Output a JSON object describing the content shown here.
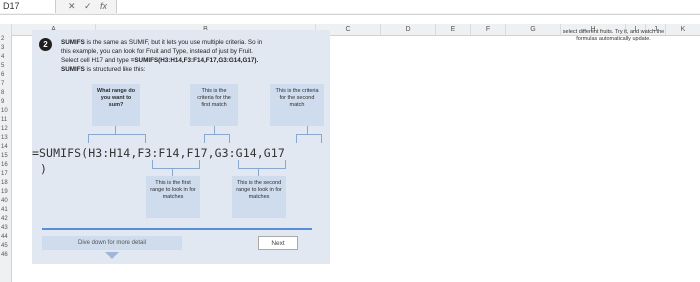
{
  "formula_bar": {
    "cell_ref": "D17",
    "cancel_icon": "✕",
    "enter_icon": "✓",
    "fx_label": "fx"
  },
  "columns": [
    "A",
    "B",
    "C",
    "D",
    "E",
    "F",
    "G",
    "H",
    "I",
    "J",
    "K"
  ],
  "rows": [
    "2",
    "3",
    "4",
    "5",
    "6",
    "7",
    "8",
    "9",
    "10",
    "11",
    "12",
    "13",
    "14",
    "15",
    "16",
    "17",
    "18",
    "19",
    "40",
    "41",
    "42",
    "43",
    "44",
    "45",
    "46"
  ],
  "step": {
    "number": "2",
    "intro_bold": "SUMIFS",
    "intro_line1": "is the same as SUMIF, but it lets you use multiple criteria. So in",
    "intro_line2": "this example, you can look for Fruit and Type, instead of just by Fruit.",
    "intro_line3_pre": "Select cell H17 and type ",
    "intro_line3_formula": "=SUMIFS(H3:H14,F3:F14,F17,G3:G14,G17).",
    "intro_line4_bold": "SUMIFS",
    "intro_line4": "is structured like this:"
  },
  "callouts": {
    "sum_range": "What range do you want to sum?",
    "criteria1": "This is the criteria for the first match",
    "criteria2": "This is the criteria for the second match",
    "range1": "This is the first range to look in for matches",
    "range2": "This is the second range to look in for matches"
  },
  "formula": {
    "line1": "=SUMIFS(H3:H14,F3:F14,F17,G3:G14,G17",
    "line2": ")"
  },
  "buttons": {
    "dive": "Dive down for more detail",
    "next": "Next"
  },
  "progress_fraction": 1.0,
  "side_note": "select different fruits. Try it, and watch the formulas automatically update."
}
